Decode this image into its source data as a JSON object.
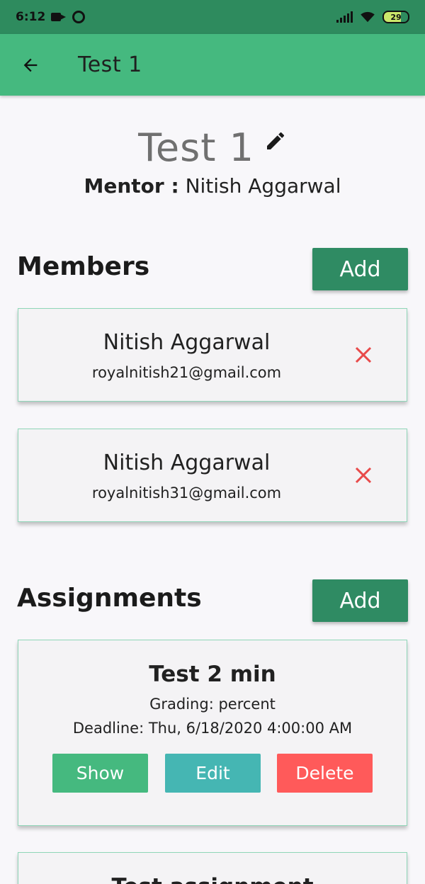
{
  "status_bar": {
    "time": "6:12",
    "battery": "29"
  },
  "app_bar": {
    "title": "Test 1"
  },
  "header": {
    "title": "Test 1",
    "mentor_label": "Mentor :",
    "mentor_name": "Nitish Aggarwal"
  },
  "members": {
    "title": "Members",
    "add_label": "Add",
    "items": [
      {
        "name": "Nitish Aggarwal",
        "email": "royalnitish21@gmail.com"
      },
      {
        "name": "Nitish Aggarwal",
        "email": "royalnitish31@gmail.com"
      }
    ]
  },
  "assignments": {
    "title": "Assignments",
    "add_label": "Add",
    "items": [
      {
        "title": "Test 2 min",
        "grading": "Grading: percent",
        "deadline": "Deadline: Thu, 6/18/2020 4:00:00 AM",
        "show_label": "Show",
        "edit_label": "Edit",
        "delete_label": "Delete"
      },
      {
        "title": "Test assignment"
      }
    ]
  },
  "colors": {
    "app_bar": "#45b97f",
    "status_bar": "#2e8b5e",
    "add_button": "#2f8b63",
    "show_button": "#45b97f",
    "edit_button": "#45b6b3",
    "delete_button": "#ff5a5a",
    "remove_icon": "#e84a4a"
  }
}
